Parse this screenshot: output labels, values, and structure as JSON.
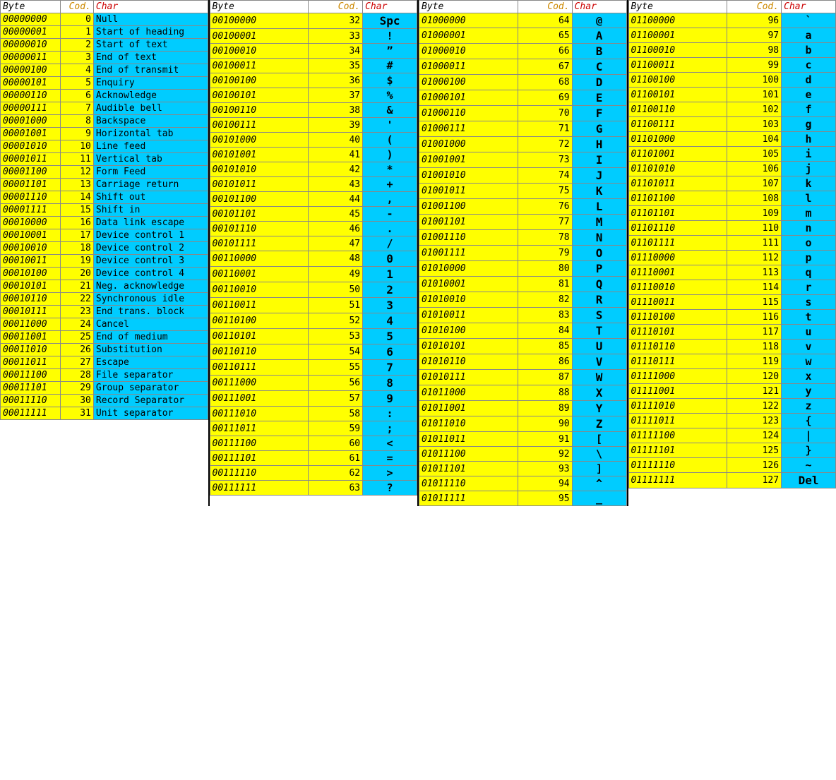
{
  "sections": [
    {
      "id": "section1",
      "headers": [
        "Byte",
        "Cod.",
        "Char"
      ],
      "rows": [
        {
          "byte": "00000000",
          "code": "0",
          "char": "",
          "name": "Null"
        },
        {
          "byte": "00000001",
          "code": "1",
          "char": "",
          "name": "Start of heading"
        },
        {
          "byte": "00000010",
          "code": "2",
          "char": "",
          "name": "Start of text"
        },
        {
          "byte": "00000011",
          "code": "3",
          "char": "",
          "name": "End of text"
        },
        {
          "byte": "00000100",
          "code": "4",
          "char": "",
          "name": "End of transmit"
        },
        {
          "byte": "00000101",
          "code": "5",
          "char": "",
          "name": "Enquiry"
        },
        {
          "byte": "00000110",
          "code": "6",
          "char": "",
          "name": "Acknowledge"
        },
        {
          "byte": "00000111",
          "code": "7",
          "char": "",
          "name": "Audible bell"
        },
        {
          "byte": "00001000",
          "code": "8",
          "char": "",
          "name": "Backspace"
        },
        {
          "byte": "00001001",
          "code": "9",
          "char": "",
          "name": "Horizontal tab"
        },
        {
          "byte": "00001010",
          "code": "10",
          "char": "",
          "name": "Line feed"
        },
        {
          "byte": "00001011",
          "code": "11",
          "char": "",
          "name": "Vertical tab"
        },
        {
          "byte": "00001100",
          "code": "12",
          "char": "",
          "name": "Form Feed"
        },
        {
          "byte": "00001101",
          "code": "13",
          "char": "",
          "name": "Carriage return"
        },
        {
          "byte": "00001110",
          "code": "14",
          "char": "",
          "name": "Shift out"
        },
        {
          "byte": "00001111",
          "code": "15",
          "char": "",
          "name": "Shift in"
        },
        {
          "byte": "00010000",
          "code": "16",
          "char": "",
          "name": "Data link escape"
        },
        {
          "byte": "00010001",
          "code": "17",
          "char": "",
          "name": "Device control 1"
        },
        {
          "byte": "00010010",
          "code": "18",
          "char": "",
          "name": "Device control 2"
        },
        {
          "byte": "00010011",
          "code": "19",
          "char": "",
          "name": "Device control 3"
        },
        {
          "byte": "00010100",
          "code": "20",
          "char": "",
          "name": "Device control 4"
        },
        {
          "byte": "00010101",
          "code": "21",
          "char": "",
          "name": "Neg. acknowledge"
        },
        {
          "byte": "00010110",
          "code": "22",
          "char": "",
          "name": "Synchronous idle"
        },
        {
          "byte": "00010111",
          "code": "23",
          "char": "",
          "name": "End trans. block"
        },
        {
          "byte": "00011000",
          "code": "24",
          "char": "",
          "name": "Cancel"
        },
        {
          "byte": "00011001",
          "code": "25",
          "char": "",
          "name": "End of medium"
        },
        {
          "byte": "00011010",
          "code": "26",
          "char": "",
          "name": "Substitution"
        },
        {
          "byte": "00011011",
          "code": "27",
          "char": "",
          "name": "Escape"
        },
        {
          "byte": "00011100",
          "code": "28",
          "char": "",
          "name": "File separator"
        },
        {
          "byte": "00011101",
          "code": "29",
          "char": "",
          "name": "Group separator"
        },
        {
          "byte": "00011110",
          "code": "30",
          "char": "",
          "name": "Record Separator"
        },
        {
          "byte": "00011111",
          "code": "31",
          "char": "",
          "name": "Unit separator"
        }
      ]
    },
    {
      "id": "section2",
      "headers": [
        "Byte",
        "Cod.",
        "Char"
      ],
      "rows": [
        {
          "byte": "00100000",
          "code": "32",
          "char": "Spc",
          "name": ""
        },
        {
          "byte": "00100001",
          "code": "33",
          "char": "!",
          "name": ""
        },
        {
          "byte": "00100010",
          "code": "34",
          "char": "”",
          "name": ""
        },
        {
          "byte": "00100011",
          "code": "35",
          "char": "#",
          "name": ""
        },
        {
          "byte": "00100100",
          "code": "36",
          "char": "$",
          "name": ""
        },
        {
          "byte": "00100101",
          "code": "37",
          "char": "%",
          "name": ""
        },
        {
          "byte": "00100110",
          "code": "38",
          "char": "&",
          "name": ""
        },
        {
          "byte": "00100111",
          "code": "39",
          "char": "'",
          "name": ""
        },
        {
          "byte": "00101000",
          "code": "40",
          "char": "(",
          "name": ""
        },
        {
          "byte": "00101001",
          "code": "41",
          "char": ")",
          "name": ""
        },
        {
          "byte": "00101010",
          "code": "42",
          "char": "*",
          "name": ""
        },
        {
          "byte": "00101011",
          "code": "43",
          "char": "+",
          "name": ""
        },
        {
          "byte": "00101100",
          "code": "44",
          "char": ",",
          "name": ""
        },
        {
          "byte": "00101101",
          "code": "45",
          "char": "-",
          "name": ""
        },
        {
          "byte": "00101110",
          "code": "46",
          "char": ".",
          "name": ""
        },
        {
          "byte": "00101111",
          "code": "47",
          "char": "/",
          "name": ""
        },
        {
          "byte": "00110000",
          "code": "48",
          "char": "0",
          "name": ""
        },
        {
          "byte": "00110001",
          "code": "49",
          "char": "1",
          "name": ""
        },
        {
          "byte": "00110010",
          "code": "50",
          "char": "2",
          "name": ""
        },
        {
          "byte": "00110011",
          "code": "51",
          "char": "3",
          "name": ""
        },
        {
          "byte": "00110100",
          "code": "52",
          "char": "4",
          "name": ""
        },
        {
          "byte": "00110101",
          "code": "53",
          "char": "5",
          "name": ""
        },
        {
          "byte": "00110110",
          "code": "54",
          "char": "6",
          "name": ""
        },
        {
          "byte": "00110111",
          "code": "55",
          "char": "7",
          "name": ""
        },
        {
          "byte": "00111000",
          "code": "56",
          "char": "8",
          "name": ""
        },
        {
          "byte": "00111001",
          "code": "57",
          "char": "9",
          "name": ""
        },
        {
          "byte": "00111010",
          "code": "58",
          "char": ":",
          "name": ""
        },
        {
          "byte": "00111011",
          "code": "59",
          "char": ";",
          "name": ""
        },
        {
          "byte": "00111100",
          "code": "60",
          "char": "<",
          "name": ""
        },
        {
          "byte": "00111101",
          "code": "61",
          "char": "=",
          "name": ""
        },
        {
          "byte": "00111110",
          "code": "62",
          "char": ">",
          "name": ""
        },
        {
          "byte": "00111111",
          "code": "63",
          "char": "?",
          "name": ""
        }
      ]
    },
    {
      "id": "section3",
      "headers": [
        "Byte",
        "Cod.",
        "Char"
      ],
      "rows": [
        {
          "byte": "01000000",
          "code": "64",
          "char": "@",
          "name": ""
        },
        {
          "byte": "01000001",
          "code": "65",
          "char": "A",
          "name": ""
        },
        {
          "byte": "01000010",
          "code": "66",
          "char": "B",
          "name": ""
        },
        {
          "byte": "01000011",
          "code": "67",
          "char": "C",
          "name": ""
        },
        {
          "byte": "01000100",
          "code": "68",
          "char": "D",
          "name": ""
        },
        {
          "byte": "01000101",
          "code": "69",
          "char": "E",
          "name": ""
        },
        {
          "byte": "01000110",
          "code": "70",
          "char": "F",
          "name": ""
        },
        {
          "byte": "01000111",
          "code": "71",
          "char": "G",
          "name": ""
        },
        {
          "byte": "01001000",
          "code": "72",
          "char": "H",
          "name": ""
        },
        {
          "byte": "01001001",
          "code": "73",
          "char": "I",
          "name": ""
        },
        {
          "byte": "01001010",
          "code": "74",
          "char": "J",
          "name": ""
        },
        {
          "byte": "01001011",
          "code": "75",
          "char": "K",
          "name": ""
        },
        {
          "byte": "01001100",
          "code": "76",
          "char": "L",
          "name": ""
        },
        {
          "byte": "01001101",
          "code": "77",
          "char": "M",
          "name": ""
        },
        {
          "byte": "01001110",
          "code": "78",
          "char": "N",
          "name": ""
        },
        {
          "byte": "01001111",
          "code": "79",
          "char": "O",
          "name": ""
        },
        {
          "byte": "01010000",
          "code": "80",
          "char": "P",
          "name": ""
        },
        {
          "byte": "01010001",
          "code": "81",
          "char": "Q",
          "name": ""
        },
        {
          "byte": "01010010",
          "code": "82",
          "char": "R",
          "name": ""
        },
        {
          "byte": "01010011",
          "code": "83",
          "char": "S",
          "name": ""
        },
        {
          "byte": "01010100",
          "code": "84",
          "char": "T",
          "name": ""
        },
        {
          "byte": "01010101",
          "code": "85",
          "char": "U",
          "name": ""
        },
        {
          "byte": "01010110",
          "code": "86",
          "char": "V",
          "name": ""
        },
        {
          "byte": "01010111",
          "code": "87",
          "char": "W",
          "name": ""
        },
        {
          "byte": "01011000",
          "code": "88",
          "char": "X",
          "name": ""
        },
        {
          "byte": "01011001",
          "code": "89",
          "char": "Y",
          "name": ""
        },
        {
          "byte": "01011010",
          "code": "90",
          "char": "Z",
          "name": ""
        },
        {
          "byte": "01011011",
          "code": "91",
          "char": "[",
          "name": ""
        },
        {
          "byte": "01011100",
          "code": "92",
          "char": "\\",
          "name": ""
        },
        {
          "byte": "01011101",
          "code": "93",
          "char": "]",
          "name": ""
        },
        {
          "byte": "01011110",
          "code": "94",
          "char": "^",
          "name": ""
        },
        {
          "byte": "01011111",
          "code": "95",
          "char": "_",
          "name": ""
        }
      ]
    },
    {
      "id": "section4",
      "headers": [
        "Byte",
        "Cod.",
        "Char"
      ],
      "rows": [
        {
          "byte": "01100000",
          "code": "96",
          "char": "`",
          "name": ""
        },
        {
          "byte": "01100001",
          "code": "97",
          "char": "a",
          "name": ""
        },
        {
          "byte": "01100010",
          "code": "98",
          "char": "b",
          "name": ""
        },
        {
          "byte": "01100011",
          "code": "99",
          "char": "c",
          "name": ""
        },
        {
          "byte": "01100100",
          "code": "100",
          "char": "d",
          "name": ""
        },
        {
          "byte": "01100101",
          "code": "101",
          "char": "e",
          "name": ""
        },
        {
          "byte": "01100110",
          "code": "102",
          "char": "f",
          "name": ""
        },
        {
          "byte": "01100111",
          "code": "103",
          "char": "g",
          "name": ""
        },
        {
          "byte": "01101000",
          "code": "104",
          "char": "h",
          "name": ""
        },
        {
          "byte": "01101001",
          "code": "105",
          "char": "i",
          "name": ""
        },
        {
          "byte": "01101010",
          "code": "106",
          "char": "j",
          "name": ""
        },
        {
          "byte": "01101011",
          "code": "107",
          "char": "k",
          "name": ""
        },
        {
          "byte": "01101100",
          "code": "108",
          "char": "l",
          "name": ""
        },
        {
          "byte": "01101101",
          "code": "109",
          "char": "m",
          "name": ""
        },
        {
          "byte": "01101110",
          "code": "110",
          "char": "n",
          "name": ""
        },
        {
          "byte": "01101111",
          "code": "111",
          "char": "o",
          "name": ""
        },
        {
          "byte": "01110000",
          "code": "112",
          "char": "p",
          "name": ""
        },
        {
          "byte": "01110001",
          "code": "113",
          "char": "q",
          "name": ""
        },
        {
          "byte": "01110010",
          "code": "114",
          "char": "r",
          "name": ""
        },
        {
          "byte": "01110011",
          "code": "115",
          "char": "s",
          "name": ""
        },
        {
          "byte": "01110100",
          "code": "116",
          "char": "t",
          "name": ""
        },
        {
          "byte": "01110101",
          "code": "117",
          "char": "u",
          "name": ""
        },
        {
          "byte": "01110110",
          "code": "118",
          "char": "v",
          "name": ""
        },
        {
          "byte": "01110111",
          "code": "119",
          "char": "w",
          "name": ""
        },
        {
          "byte": "01111000",
          "code": "120",
          "char": "x",
          "name": ""
        },
        {
          "byte": "01111001",
          "code": "121",
          "char": "y",
          "name": ""
        },
        {
          "byte": "01111010",
          "code": "122",
          "char": "z",
          "name": ""
        },
        {
          "byte": "01111011",
          "code": "123",
          "char": "{",
          "name": ""
        },
        {
          "byte": "01111100",
          "code": "124",
          "char": "|",
          "name": ""
        },
        {
          "byte": "01111101",
          "code": "125",
          "char": "}",
          "name": ""
        },
        {
          "byte": "01111110",
          "code": "126",
          "char": "~",
          "name": ""
        },
        {
          "byte": "01111111",
          "code": "127",
          "char": "Del",
          "name": ""
        }
      ]
    }
  ]
}
